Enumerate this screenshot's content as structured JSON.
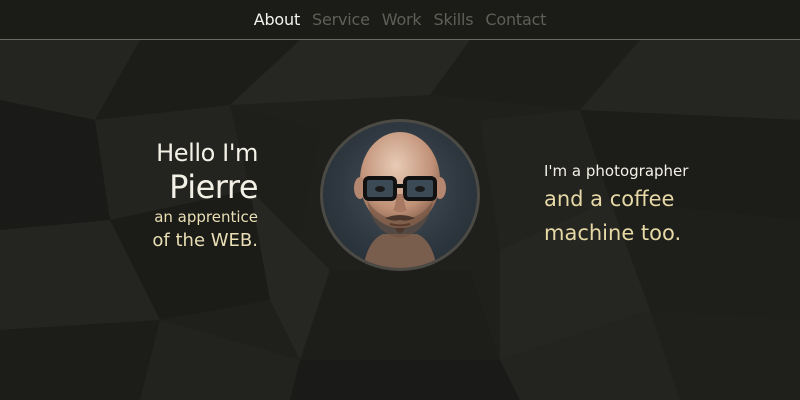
{
  "nav": {
    "items": [
      {
        "label": "About",
        "active": true
      },
      {
        "label": "Service",
        "active": false
      },
      {
        "label": "Work",
        "active": false
      },
      {
        "label": "Skills",
        "active": false
      },
      {
        "label": "Contact",
        "active": false
      }
    ]
  },
  "hero": {
    "greeting": "Hello I'm",
    "name": "Pierre",
    "tagline_line1": "an apprentice",
    "tagline_line2": "of the WEB.",
    "intro": "I'm a photographer",
    "description_line1": "and a coffee",
    "description_line2": "machine too."
  },
  "colors": {
    "background": "#1f1f1c",
    "nav_active": "#f2f2ee",
    "nav_inactive": "#5f5f57",
    "accent_text": "#e6d9a6",
    "primary_text": "#f3f1e6"
  },
  "icons": {
    "avatar": "portrait-photo"
  }
}
